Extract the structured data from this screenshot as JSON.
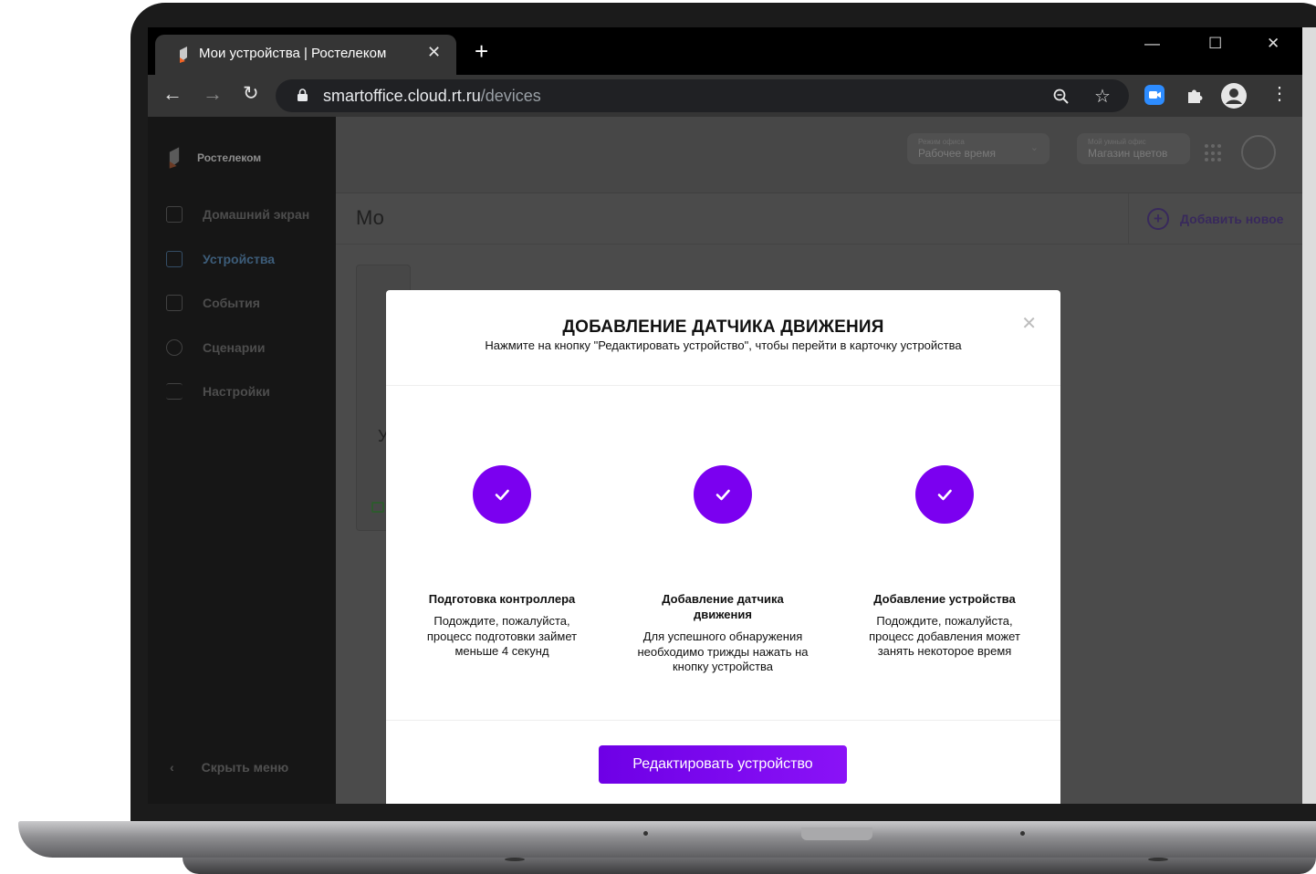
{
  "browser": {
    "tab_title": "Мои устройства | Ростелеком",
    "tab_close": "✕",
    "new_tab": "+",
    "window_controls": [
      "—",
      "☐",
      "✕"
    ],
    "url_host": "smartoffice.cloud.rt.ru",
    "url_path": "/devices",
    "icons": [
      "back-icon",
      "forward-icon",
      "reload-icon",
      "lock-icon",
      "zoom-icon",
      "star-icon",
      "zoom-app-icon",
      "extensions-icon",
      "profile-icon",
      "menu-icon"
    ]
  },
  "sidebar": {
    "brand": "Ростелеком",
    "items": [
      {
        "label": "Домашний экран",
        "icon": "grid-icon"
      },
      {
        "label": "Устройства",
        "icon": "device-icon"
      },
      {
        "label": "События",
        "icon": "calendar-icon"
      },
      {
        "label": "Сценарии",
        "icon": "scenario-icon"
      },
      {
        "label": "Настройки",
        "icon": "sliders-icon"
      }
    ],
    "hide_menu": "Скрыть меню"
  },
  "header": {
    "office_mode_caption": "Режим офиса",
    "office_mode_value": "Рабочее время",
    "smart_office_caption": "Мой умный офис",
    "smart_office_value": "Магазин цветов"
  },
  "subheader": {
    "page_title": "Мо",
    "add_new": "Добавить новое"
  },
  "background_card": {
    "letter": "У"
  },
  "modal": {
    "title": "ДОБАВЛЕНИЕ ДАТЧИКА ДВИЖЕНИЯ",
    "subtitle": "Нажмите на кнопку \"Редактировать устройство\", чтобы перейти в карточку устройства",
    "close": "✕",
    "steps": [
      {
        "title": "Подготовка контроллера",
        "desc": "Подождите, пожалуйста, процесс подготовки займет меньше 4 секунд"
      },
      {
        "title": "Добавление датчика движения",
        "desc": "Для успешного обнаружения необходимо трижды нажать на кнопку устройства"
      },
      {
        "title": "Добавление устройства",
        "desc": "Подождите, пожалуйста, процесс добавления может занять некоторое время"
      }
    ],
    "button": "Редактировать устройство"
  },
  "colors": {
    "accent": "#7b00f0",
    "chrome_bg": "#353535",
    "sidebar_bg": "#161616"
  }
}
